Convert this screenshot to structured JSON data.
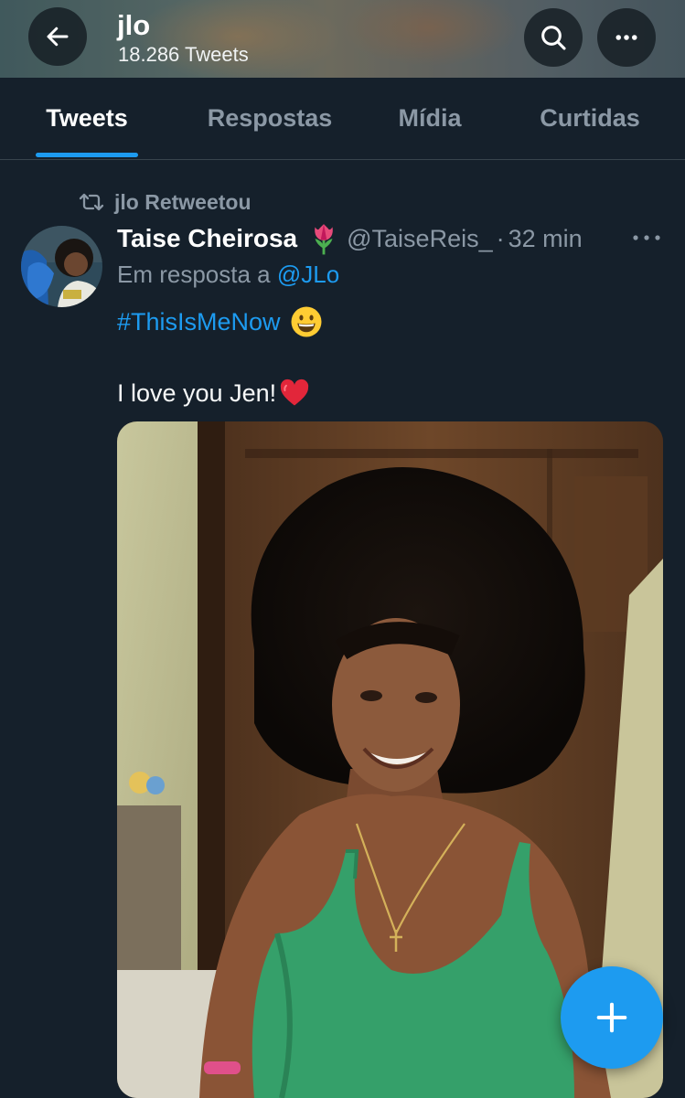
{
  "header": {
    "title": "jlo",
    "tweet_count": "18.286 Tweets"
  },
  "tabs": [
    {
      "label": "Tweets",
      "active": true
    },
    {
      "label": "Respostas",
      "active": false
    },
    {
      "label": "Mídia",
      "active": false
    },
    {
      "label": "Curtidas",
      "active": false
    }
  ],
  "tweet": {
    "retweet_label": "jlo Retweetou",
    "author_name": "Taise Cheirosa",
    "author_emoji": "tulip",
    "handle": "@TaiseReis_",
    "separator": "·",
    "time": "32 min",
    "reply_prefix": "Em resposta a",
    "reply_to": "@JLo",
    "hashtag": "#ThisIsMeNow",
    "hashtag_emoji": "grinning-face",
    "body": "I love you Jen!",
    "body_emoji": "red-heart"
  },
  "icons": {
    "back": "arrow-left-icon",
    "search": "search-icon",
    "more": "more-horizontal-icon",
    "retweet": "retweet-icon",
    "compose": "plus-icon"
  },
  "colors": {
    "background": "#15202b",
    "accent": "#1d9bf0",
    "secondary_text": "#8b98a5",
    "divider": "#38444d"
  }
}
